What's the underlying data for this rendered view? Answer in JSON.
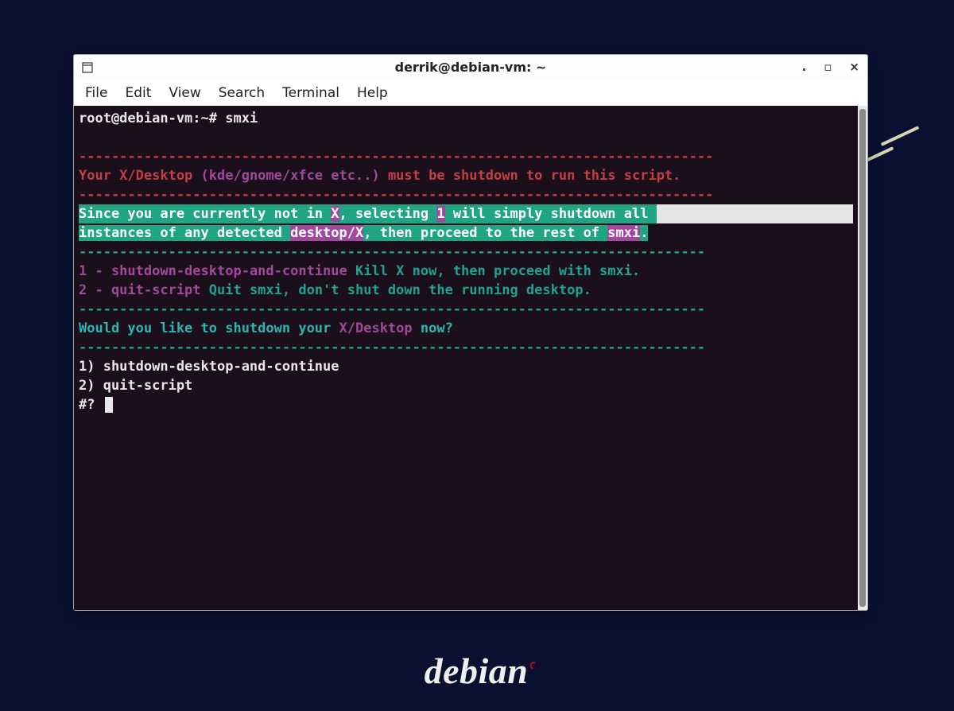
{
  "window": {
    "title": "derrik@debian-vm: ~"
  },
  "menubar": {
    "items": [
      "File",
      "Edit",
      "View",
      "Search",
      "Terminal",
      "Help"
    ]
  },
  "terminal": {
    "prompt": "root@debian-vm:~# ",
    "command": "smxi",
    "dash_red": "------------------------------------------------------------------------------",
    "warn_pre": "Your X/Desktop",
    "warn_paren": " (kde/gnome/xfce etc..) ",
    "warn_post": "must be shutdown to run this script.",
    "dash_teal": "-----------------------------------------------------------------------------",
    "info_line1_a": "Since you are currently not in ",
    "info_line1_X": "X",
    "info_line1_b": ", selecting ",
    "info_line1_1": "1",
    "info_line1_c": " will simply shutdown all ",
    "info_line2_a": "instances of any detected ",
    "info_line2_dx": "desktop/X",
    "info_line2_b": ", then proceed to the rest of ",
    "info_line2_sm": "smxi",
    "info_line2_c": ".",
    "opt1_num": "1 - shutdown-desktop-and-continue",
    "opt1_desc": " Kill X now, then proceed with smxi.",
    "opt2_num": "2 - quit-script",
    "opt2_desc": " Quit smxi, don't shut down the running desktop.",
    "question_a": "Would you like to shutdown your ",
    "question_b": "X/Desktop",
    "question_c": " now?",
    "menu1": "1) shutdown-desktop-and-continue",
    "menu2": "2) quit-script",
    "input_prompt": "#? "
  },
  "desktop": {
    "logo_text": "debian"
  }
}
